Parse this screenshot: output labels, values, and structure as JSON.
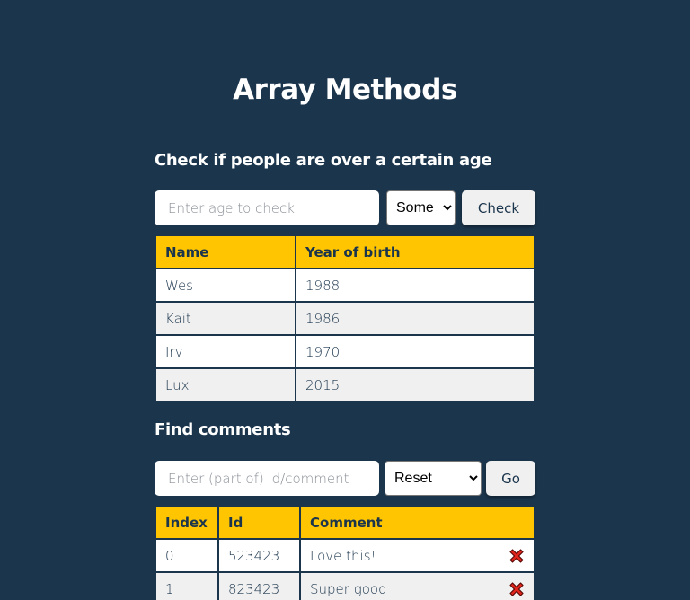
{
  "page": {
    "title": "Array Methods"
  },
  "age_section": {
    "heading": "Check if people are over a certain age",
    "input_placeholder": "Enter age to check",
    "mode_selected": "Some",
    "check_label": "Check",
    "columns": [
      "Name",
      "Year of birth"
    ],
    "rows": [
      {
        "name": "Wes",
        "year": "1988"
      },
      {
        "name": "Kait",
        "year": "1986"
      },
      {
        "name": "Irv",
        "year": "1970"
      },
      {
        "name": "Lux",
        "year": "2015"
      }
    ]
  },
  "comments_section": {
    "heading": "Find comments",
    "input_placeholder": "Enter (part of) id/comment",
    "mode_selected": "Reset",
    "go_label": "Go",
    "columns": [
      "Index",
      "Id",
      "Comment"
    ],
    "rows": [
      {
        "index": "0",
        "id": "523423",
        "comment": "Love this!",
        "delete_icon": "red-x-icon"
      },
      {
        "index": "1",
        "id": "823423",
        "comment": "Super good",
        "delete_icon": "red-x-icon"
      }
    ]
  },
  "colors": {
    "background": "#1b354c",
    "accent": "#ffc501",
    "delete": "#e0261c"
  }
}
